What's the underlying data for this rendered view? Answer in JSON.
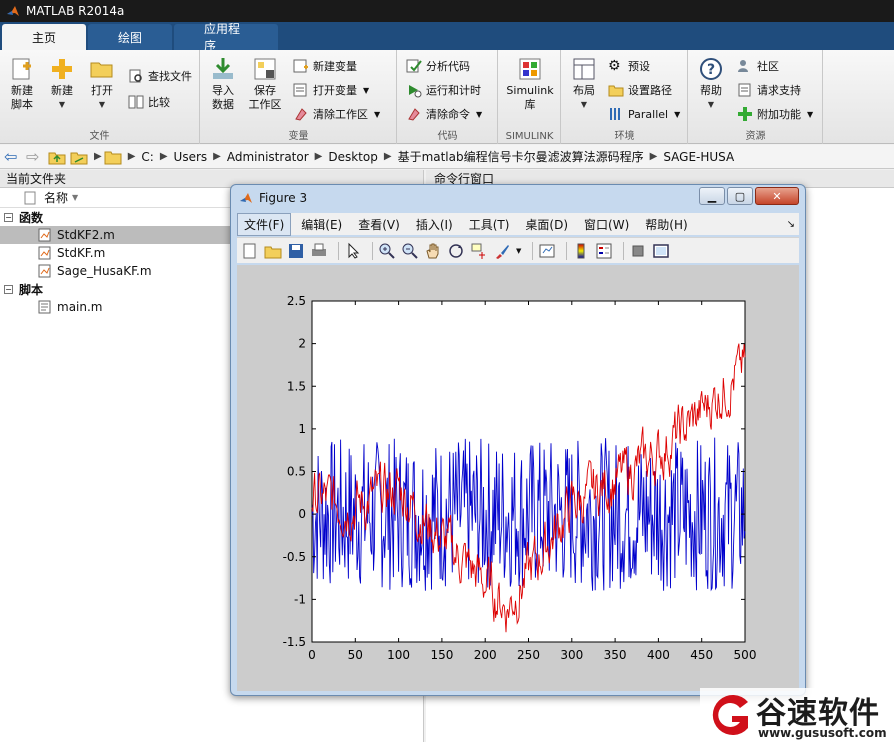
{
  "window": {
    "title": "MATLAB R2014a"
  },
  "tabs": [
    {
      "label": "主页",
      "active": true
    },
    {
      "label": "绘图",
      "active": false
    },
    {
      "label": "应用程序",
      "active": false
    }
  ],
  "ribbon": {
    "file": {
      "label": "文件",
      "new_script": "新建\n脚本",
      "new": "新建",
      "open": "打开",
      "find_files": "查找文件",
      "compare": "比较"
    },
    "variable": {
      "label": "变量",
      "import": "导入\n数据",
      "save": "保存\n工作区",
      "new_variable": "新建变量",
      "open_variable": "打开变量",
      "clear_workspace": "清除工作区"
    },
    "code": {
      "label": "代码",
      "analyze": "分析代码",
      "run_time": "运行和计时",
      "clear_commands": "清除命令"
    },
    "simulink": {
      "label": "SIMULINK",
      "library": "Simulink\n库"
    },
    "environment": {
      "label": "环境",
      "layout": "布局",
      "preferences": "预设",
      "set_path": "设置路径",
      "parallel": "Parallel"
    },
    "resources": {
      "label": "资源",
      "help": "帮助",
      "community": "社区",
      "request_support": "请求支持",
      "addons": "附加功能"
    }
  },
  "path": {
    "crumbs": [
      "C:",
      "Users",
      "Administrator",
      "Desktop",
      "基于matlab编程信号卡尔曼滤波算法源码程序",
      "SAGE-HUSA"
    ]
  },
  "folder_panel": {
    "title": "当前文件夹",
    "column_name": "名称",
    "sections": [
      {
        "label": "函数",
        "files": [
          "StdKF2.m",
          "StdKF.m",
          "Sage_HusaKF.m"
        ]
      },
      {
        "label": "脚本",
        "files": [
          "main.m"
        ]
      }
    ],
    "selected_file": "StdKF2.m"
  },
  "command_window": {
    "title": "命令行窗口"
  },
  "figure": {
    "title": "Figure 3",
    "menus": [
      "文件(F)",
      "编辑(E)",
      "查看(V)",
      "插入(I)",
      "工具(T)",
      "桌面(D)",
      "窗口(W)",
      "帮助(H)"
    ],
    "active_menu": "文件(F)"
  },
  "chart_data": {
    "type": "line",
    "xlim": [
      0,
      500
    ],
    "ylim": [
      -1.5,
      2.5
    ],
    "xticks": [
      0,
      50,
      100,
      150,
      200,
      250,
      300,
      350,
      400,
      450,
      500
    ],
    "yticks": [
      2.5,
      2,
      1.5,
      1,
      0.5,
      0,
      -0.5,
      -1,
      -1.5
    ],
    "xtick_labels": [
      "0",
      "50",
      "100",
      "150",
      "200",
      "250",
      "300",
      "350",
      "400",
      "450",
      "500"
    ],
    "ytick_labels": [
      "2.5",
      "2",
      "1.5",
      "1",
      "0.5",
      "0",
      "-0.5",
      "-1",
      "-1.5"
    ],
    "grid": false,
    "legend": "none",
    "series": [
      {
        "color": "#0000cc",
        "style": "noise",
        "trend": [
          [
            0,
            0
          ],
          [
            500,
            0
          ]
        ],
        "amplitude": 0.9
      },
      {
        "color": "#dd0000",
        "style": "noise",
        "trend": [
          [
            0,
            0.2
          ],
          [
            50,
            0.1
          ],
          [
            100,
            0.3
          ],
          [
            150,
            -0.3
          ],
          [
            200,
            -0.8
          ],
          [
            225,
            -1.1
          ],
          [
            250,
            -0.7
          ],
          [
            300,
            0.1
          ],
          [
            350,
            0.4
          ],
          [
            400,
            0.7
          ],
          [
            450,
            1.2
          ],
          [
            500,
            1.75
          ]
        ],
        "amplitude": 0.25
      }
    ]
  },
  "watermark": {
    "name": "谷速软件",
    "url": "www.gususoft.com"
  },
  "colors": {
    "ribbon_blue": "#1f4c7d",
    "figure_frame": "#c6d9ee",
    "blue_series": "#0000cc",
    "red_series": "#dd0000"
  }
}
